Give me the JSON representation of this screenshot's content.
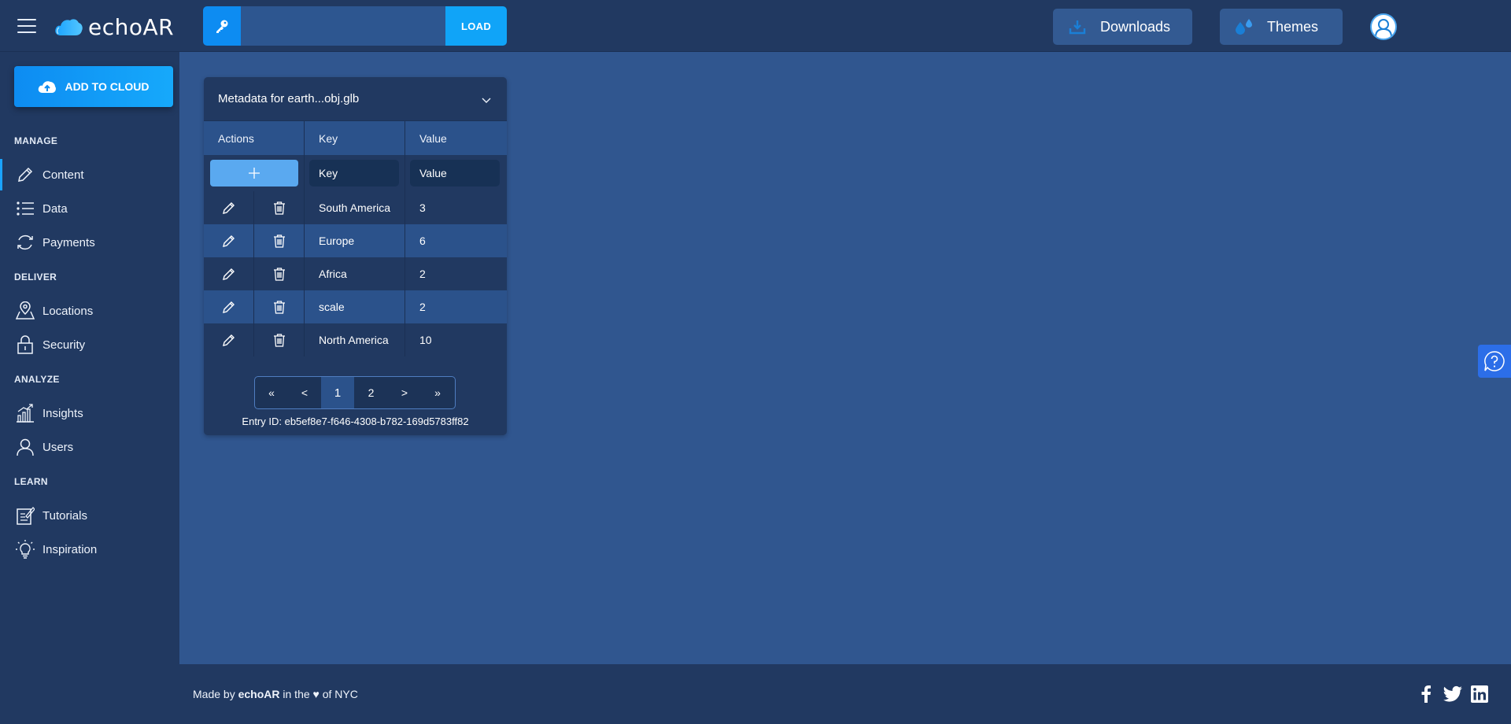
{
  "header": {
    "brand": "echoAR",
    "search_placeholder": "",
    "load_label": "LOAD",
    "downloads_label": "Downloads",
    "themes_label": "Themes"
  },
  "sidebar": {
    "add_to_cloud_label": "ADD TO CLOUD",
    "sections": [
      {
        "title": "MANAGE",
        "items": [
          {
            "label": "Content",
            "icon": "pencil-icon",
            "active": true
          },
          {
            "label": "Data",
            "icon": "list-icon"
          },
          {
            "label": "Payments",
            "icon": "refresh-icon"
          }
        ]
      },
      {
        "title": "DELIVER",
        "items": [
          {
            "label": "Locations",
            "icon": "map-pin-icon"
          },
          {
            "label": "Security",
            "icon": "lock-icon"
          }
        ]
      },
      {
        "title": "ANALYZE",
        "items": [
          {
            "label": "Insights",
            "icon": "bar-chart-icon"
          },
          {
            "label": "Users",
            "icon": "user-icon"
          }
        ]
      },
      {
        "title": "LEARN",
        "items": [
          {
            "label": "Tutorials",
            "icon": "notepad-icon"
          },
          {
            "label": "Inspiration",
            "icon": "lightbulb-icon"
          }
        ]
      }
    ]
  },
  "panel": {
    "title": "Metadata for earth...obj.glb",
    "columns": {
      "actions": "Actions",
      "key": "Key",
      "value": "Value"
    },
    "key_placeholder": "Key",
    "value_placeholder": "Value",
    "rows": [
      {
        "key": "South America",
        "value": "3"
      },
      {
        "key": "Europe",
        "value": "6"
      },
      {
        "key": "Africa",
        "value": "2"
      },
      {
        "key": "scale",
        "value": "2"
      },
      {
        "key": "North America",
        "value": "10"
      }
    ],
    "pagination": {
      "first": "«",
      "prev": "<",
      "pages": [
        "1",
        "2"
      ],
      "current": "1",
      "next": ">",
      "last": "»"
    },
    "entry_id": "Entry ID: eb5ef8e7-f646-4308-b782-169d5783ff82"
  },
  "footer": {
    "made_by_prefix": "Made by ",
    "made_by_brand": "echoAR",
    "made_by_middle": " in the ",
    "heart": "♥",
    "made_by_suffix": " of NYC"
  },
  "colors": {
    "background": "#30568f",
    "bars": "#213961",
    "accent": "#10a4f8",
    "row_alt": "#2b528b"
  }
}
